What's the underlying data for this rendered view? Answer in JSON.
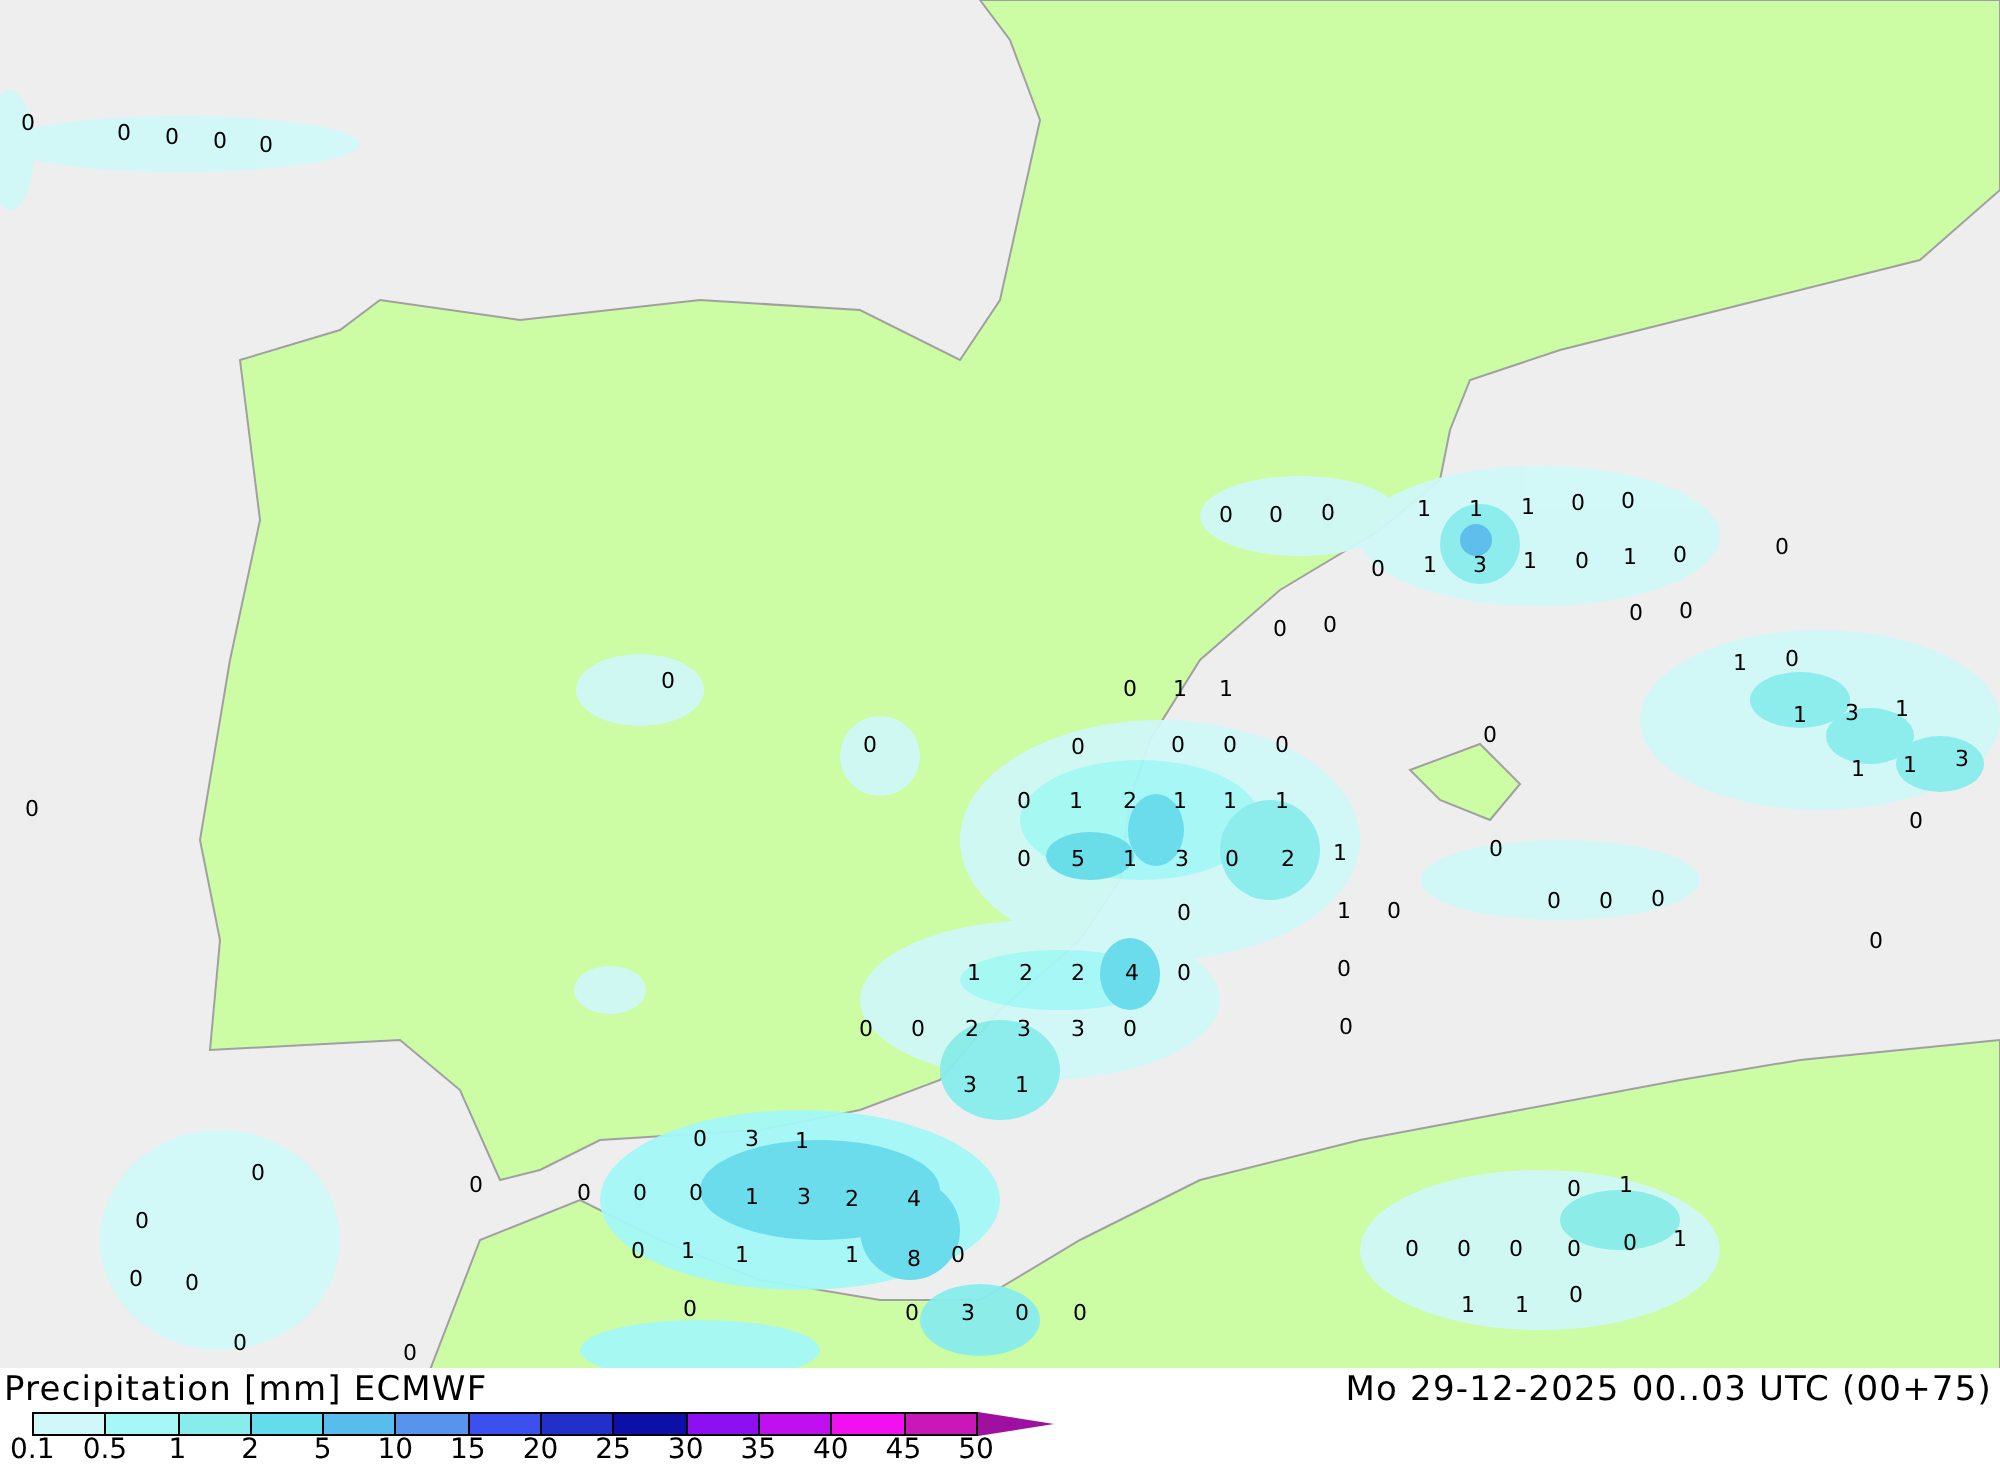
{
  "map_labels": [
    "0",
    "0",
    "0",
    "0",
    "0",
    "0",
    "0",
    "0",
    "1",
    "1",
    "1",
    "0",
    "0",
    "0",
    "1",
    "3",
    "1",
    "0",
    "1",
    "0",
    "0",
    "0",
    "0",
    "0",
    "0",
    "1",
    "0",
    "0",
    "0",
    "1",
    "1",
    "1",
    "3",
    "1",
    "0",
    "0",
    "0",
    "0",
    "0",
    "0",
    "1",
    "1",
    "3",
    "0",
    "0",
    "1",
    "2",
    "1",
    "1",
    "1",
    "0",
    "0",
    "5",
    "1",
    "3",
    "0",
    "2",
    "1",
    "0",
    "0",
    "0",
    "0",
    "0",
    "1",
    "0",
    "0",
    "1",
    "2",
    "2",
    "4",
    "0",
    "0",
    "0",
    "0",
    "2",
    "3",
    "3",
    "0",
    "0",
    "3",
    "1",
    "0",
    "3",
    "1",
    "0",
    "0",
    "0",
    "0",
    "0",
    "1",
    "3",
    "2",
    "4",
    "0",
    "1",
    "0",
    "0",
    "1",
    "1",
    "1",
    "8",
    "0",
    "0",
    "0",
    "0",
    "0",
    "0",
    "1",
    "0",
    "0",
    "0",
    "0",
    "3",
    "0",
    "0",
    "1",
    "1",
    "0",
    "0",
    "0"
  ],
  "title": "Precipitation [mm] ECMWF",
  "valid_time": "Mo 29-12-2025 00..03 UTC (00+75)",
  "legend": {
    "bins": [
      {
        "color": "#d0f8f8"
      },
      {
        "color": "#a4f8f8"
      },
      {
        "color": "#88ecec"
      },
      {
        "color": "#64dcec"
      },
      {
        "color": "#58bcec"
      },
      {
        "color": "#5894ec"
      },
      {
        "color": "#3c50f0"
      },
      {
        "color": "#2030c8"
      },
      {
        "color": "#0c10a8"
      },
      {
        "color": "#8c10f0"
      },
      {
        "color": "#c010f0"
      },
      {
        "color": "#f010f0"
      },
      {
        "color": "#c818b8"
      },
      {
        "color": "#a010a0",
        "kind": "arrow"
      }
    ],
    "ticks": [
      "0.1",
      "0.5",
      "1",
      "2",
      "5",
      "10",
      "15",
      "20",
      "25",
      "30",
      "35",
      "40",
      "45",
      "50"
    ]
  }
}
